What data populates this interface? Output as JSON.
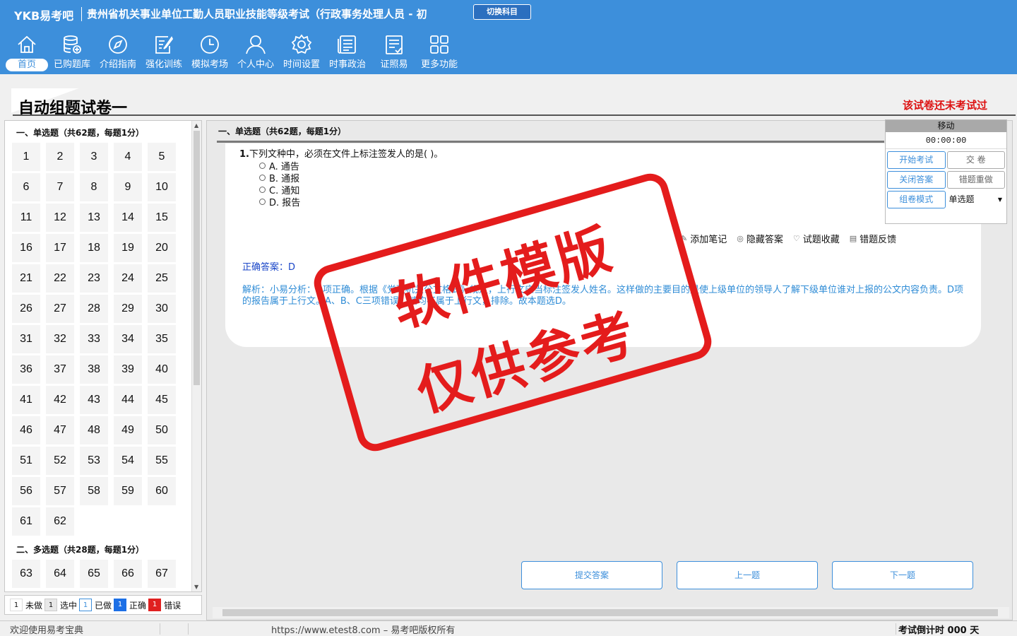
{
  "header": {
    "logo": "YKB易考吧",
    "app_title": "贵州省机关事业单位工勤人员职业技能等级考试（行政事务处理人员 - 初",
    "switch_label": "切换科目",
    "nav": [
      {
        "label": "首页",
        "icon": "home-icon"
      },
      {
        "label": "已购题库",
        "icon": "database-icon"
      },
      {
        "label": "介绍指南",
        "icon": "compass-icon"
      },
      {
        "label": "强化训练",
        "icon": "edit-icon"
      },
      {
        "label": "模拟考场",
        "icon": "clock-icon"
      },
      {
        "label": "个人中心",
        "icon": "user-icon"
      },
      {
        "label": "时间设置",
        "icon": "gear-icon"
      },
      {
        "label": "时事政治",
        "icon": "news-icon"
      },
      {
        "label": "证照易",
        "icon": "certificate-icon"
      },
      {
        "label": "更多功能",
        "icon": "grid-icon"
      }
    ]
  },
  "paper": {
    "title": "自动组题试卷一",
    "status": "该试卷还未考试过"
  },
  "left": {
    "section1": "一、单选题（共62题，每题1分）",
    "section2": "二、多选题（共28题，每题1分）",
    "section1_numbers": [
      "1",
      "2",
      "3",
      "4",
      "5",
      "6",
      "7",
      "8",
      "9",
      "10",
      "11",
      "12",
      "13",
      "14",
      "15",
      "16",
      "17",
      "18",
      "19",
      "20",
      "21",
      "22",
      "23",
      "24",
      "25",
      "26",
      "27",
      "28",
      "29",
      "30",
      "31",
      "32",
      "33",
      "34",
      "35",
      "36",
      "37",
      "38",
      "39",
      "40",
      "41",
      "42",
      "43",
      "44",
      "45",
      "46",
      "47",
      "48",
      "49",
      "50",
      "51",
      "52",
      "53",
      "54",
      "55",
      "56",
      "57",
      "58",
      "59",
      "60",
      "61",
      "62"
    ],
    "section2_numbers": [
      "63",
      "64",
      "65",
      "66",
      "67"
    ]
  },
  "legend": {
    "undone_count": "1",
    "undone": "未做",
    "selected_count": "1",
    "selected": "选中",
    "done_count": "1",
    "done": "已做",
    "correct_count": "1",
    "correct": "正确",
    "wrong_count": "1",
    "wrong": "错误"
  },
  "question": {
    "section": "一、单选题（共62题，每题1分）",
    "number": "1.",
    "stem": "下列文种中，必须在文件上标注签发人的是(    )。",
    "options": [
      "A. 通告",
      "B. 通报",
      "C. 通知",
      "D. 报告"
    ],
    "tools": [
      "添加笔记",
      "隐藏答案",
      "试题收藏",
      "错题反馈"
    ],
    "answer": "正确答案：D",
    "analysis": "解析：小易分析：D项正确。根据《党政机关公文格式》规定，上行文应当标注签发人姓名。这样做的主要目的是使上级单位的领导人了解下级单位谁对上报的公文内容负责。D项的报告属于上行文。A、B、C三项错误。其均不属于上行文，排除。故本题选D。"
  },
  "buttons": {
    "submit": "提交答案",
    "prev": "上一题",
    "next": "下一题"
  },
  "control": {
    "move": "移动",
    "timer": "00:00:00",
    "start": "开始考试",
    "hand_in": "交    卷",
    "close_answer": "关闭答案",
    "redo_wrong": "错题重做",
    "mode": "组卷模式",
    "mode_value": "单选题"
  },
  "stamp": {
    "line1": "软件模版",
    "line2": "仅供参考"
  },
  "status": {
    "welcome": "欢迎使用易考宝典",
    "copyright": "https://www.etest8.com – 易考吧版权所有",
    "countdown": "考试倒计时 000 天"
  }
}
